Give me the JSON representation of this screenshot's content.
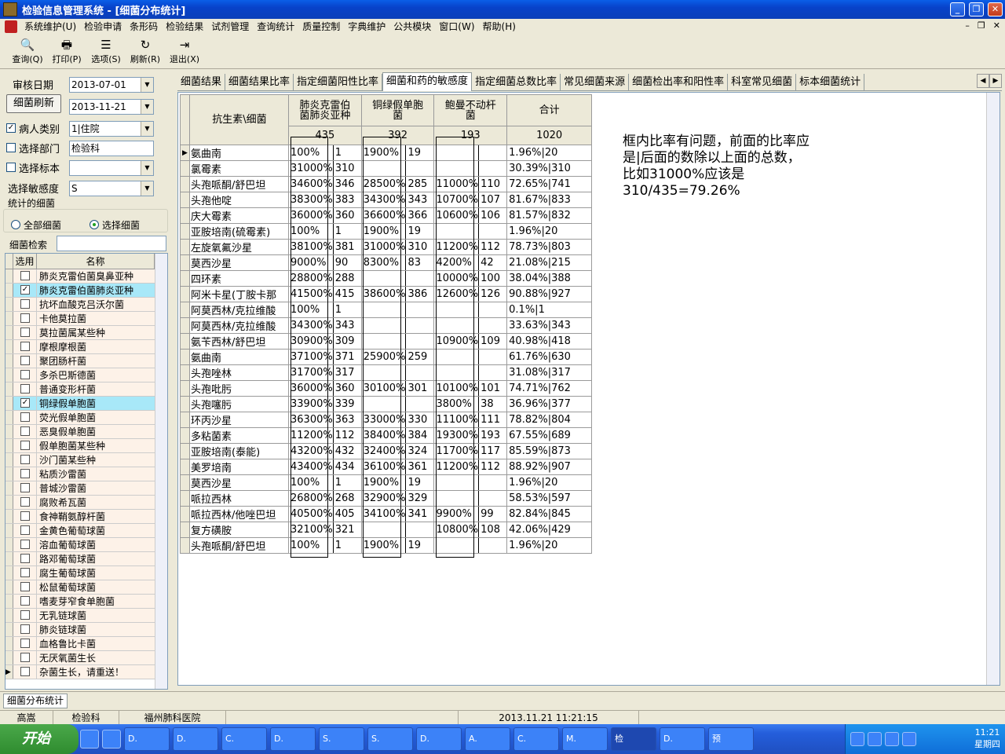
{
  "window": {
    "title": "检验信息管理系统 - [细菌分布统计]"
  },
  "menu": [
    "系统维护(U)",
    "检验申请",
    "条形码",
    "检验结果",
    "试剂管理",
    "查询统计",
    "质量控制",
    "字典维护",
    "公共模块",
    "窗口(W)",
    "帮助(H)"
  ],
  "toolbar": [
    {
      "label": "查询(Q)",
      "icon": "magnifier-icon",
      "glyph": "🔍"
    },
    {
      "label": "打印(P)",
      "icon": "printer-icon",
      "glyph": "🖶"
    },
    {
      "label": "选项(S)",
      "icon": "options-icon",
      "glyph": "☰"
    },
    {
      "label": "刷新(R)",
      "icon": "refresh-icon",
      "glyph": "↻"
    },
    {
      "label": "退出(X)",
      "icon": "exit-icon",
      "glyph": "⇥"
    }
  ],
  "filters": {
    "review_date_label": "审核日期",
    "date_from": "2013-07-01",
    "date_to": "2013-11-21",
    "refresh_button": "细菌刷新",
    "patient_type_label": "病人类别",
    "patient_type_value": "1|住院",
    "dept_label": "选择部门",
    "dept_value": "检验科",
    "specimen_label": "选择标本",
    "specimen_value": "",
    "sensitivity_label": "选择敏感度",
    "sensitivity_value": "S",
    "stat_group_label": "统计的细菌",
    "all_label": "全部细菌",
    "select_label": "选择细菌",
    "search_label": "细菌检索",
    "search_value": ""
  },
  "bacteria_list": {
    "col_use": "选用",
    "col_name": "名称",
    "items": [
      {
        "name": "肺炎克雷伯菌臭鼻亚种",
        "checked": false
      },
      {
        "name": "肺炎克雷伯菌肺炎亚种",
        "checked": true
      },
      {
        "name": "抗坏血酸克吕沃尔菌",
        "checked": false
      },
      {
        "name": "卡他莫拉菌",
        "checked": false
      },
      {
        "name": "莫拉菌属某些种",
        "checked": false
      },
      {
        "name": "摩根摩根菌",
        "checked": false
      },
      {
        "name": "聚团肠杆菌",
        "checked": false
      },
      {
        "name": "多杀巴斯德菌",
        "checked": false
      },
      {
        "name": "普通变形杆菌",
        "checked": false
      },
      {
        "name": "铜绿假单胞菌",
        "checked": true
      },
      {
        "name": "荧光假单胞菌",
        "checked": false
      },
      {
        "name": "恶臭假单胞菌",
        "checked": false
      },
      {
        "name": "假单胞菌某些种",
        "checked": false
      },
      {
        "name": "沙门菌某些种",
        "checked": false
      },
      {
        "name": "粘质沙雷菌",
        "checked": false
      },
      {
        "name": "普城沙雷菌",
        "checked": false
      },
      {
        "name": "腐败希瓦菌",
        "checked": false
      },
      {
        "name": "食神鞘氨醇杆菌",
        "checked": false
      },
      {
        "name": "金黄色葡萄球菌",
        "checked": false
      },
      {
        "name": "溶血葡萄球菌",
        "checked": false
      },
      {
        "name": "路邓葡萄球菌",
        "checked": false
      },
      {
        "name": "腐生葡萄球菌",
        "checked": false
      },
      {
        "name": "松鼠葡萄球菌",
        "checked": false
      },
      {
        "name": "嗜麦芽窄食单胞菌",
        "checked": false
      },
      {
        "name": "无乳链球菌",
        "checked": false
      },
      {
        "name": "肺炎链球菌",
        "checked": false
      },
      {
        "name": "血格鲁比卡菌",
        "checked": false
      },
      {
        "name": "无厌氧菌生长",
        "checked": false
      },
      {
        "name": "杂菌生长，请重送！",
        "checked": false
      }
    ]
  },
  "tabs": [
    "细菌结果",
    "细菌结果比率",
    "指定细菌阳性比率",
    "细菌和药的敏感度",
    "指定细菌总数比率",
    "常见细菌来源",
    "细菌检出率和阳性率",
    "科室常见细菌",
    "标本细菌统计"
  ],
  "active_tab": 3,
  "table": {
    "corner": "抗生素\\细菌",
    "columns": [
      {
        "name": "肺炎克雷伯\n菌肺炎亚种",
        "total": "435"
      },
      {
        "name": "铜绿假单胞\n菌",
        "total": "392"
      },
      {
        "name": "鲍曼不动杆\n菌",
        "total": "193"
      },
      {
        "name": "合计",
        "total": "1020"
      }
    ],
    "rows": [
      {
        "drug": "氨曲南",
        "c": [
          [
            "100%",
            "1"
          ],
          [
            "1900%",
            "19"
          ],
          [
            "",
            ""
          ]
        ],
        "total": "1.96%|20"
      },
      {
        "drug": "氯霉素",
        "c": [
          [
            "31000%",
            "310"
          ],
          [
            "",
            ""
          ],
          [
            "",
            ""
          ]
        ],
        "total": "30.39%|310"
      },
      {
        "drug": "头孢哌酮/舒巴坦",
        "c": [
          [
            "34600%",
            "346"
          ],
          [
            "28500%",
            "285"
          ],
          [
            "11000%",
            "110"
          ]
        ],
        "total": "72.65%|741"
      },
      {
        "drug": "头孢他啶",
        "c": [
          [
            "38300%",
            "383"
          ],
          [
            "34300%",
            "343"
          ],
          [
            "10700%",
            "107"
          ]
        ],
        "total": "81.67%|833"
      },
      {
        "drug": "庆大霉素",
        "c": [
          [
            "36000%",
            "360"
          ],
          [
            "36600%",
            "366"
          ],
          [
            "10600%",
            "106"
          ]
        ],
        "total": "81.57%|832"
      },
      {
        "drug": "亚胺培南(硫霉素)",
        "c": [
          [
            "100%",
            "1"
          ],
          [
            "1900%",
            "19"
          ],
          [
            "",
            ""
          ]
        ],
        "total": "1.96%|20"
      },
      {
        "drug": "左旋氧氟沙星",
        "c": [
          [
            "38100%",
            "381"
          ],
          [
            "31000%",
            "310"
          ],
          [
            "11200%",
            "112"
          ]
        ],
        "total": "78.73%|803"
      },
      {
        "drug": "莫西沙星",
        "c": [
          [
            "9000%",
            "90"
          ],
          [
            "8300%",
            "83"
          ],
          [
            "4200%",
            "42"
          ]
        ],
        "total": "21.08%|215"
      },
      {
        "drug": "四环素",
        "c": [
          [
            "28800%",
            "288"
          ],
          [
            "",
            ""
          ],
          [
            "10000%",
            "100"
          ]
        ],
        "total": "38.04%|388"
      },
      {
        "drug": "阿米卡星(丁胺卡那",
        "c": [
          [
            "41500%",
            "415"
          ],
          [
            "38600%",
            "386"
          ],
          [
            "12600%",
            "126"
          ]
        ],
        "total": "90.88%|927"
      },
      {
        "drug": "阿莫西林/克拉维酸",
        "c": [
          [
            "100%",
            "1"
          ],
          [
            "",
            ""
          ],
          [
            "",
            ""
          ]
        ],
        "total": "0.1%|1"
      },
      {
        "drug": "阿莫西林/克拉维酸",
        "c": [
          [
            "34300%",
            "343"
          ],
          [
            "",
            ""
          ],
          [
            "",
            ""
          ]
        ],
        "total": "33.63%|343"
      },
      {
        "drug": "氨苄西林/舒巴坦",
        "c": [
          [
            "30900%",
            "309"
          ],
          [
            "",
            ""
          ],
          [
            "10900%",
            "109"
          ]
        ],
        "total": "40.98%|418"
      },
      {
        "drug": "氨曲南",
        "c": [
          [
            "37100%",
            "371"
          ],
          [
            "25900%",
            "259"
          ],
          [
            "",
            ""
          ]
        ],
        "total": "61.76%|630"
      },
      {
        "drug": "头孢唑林",
        "c": [
          [
            "31700%",
            "317"
          ],
          [
            "",
            ""
          ],
          [
            "",
            ""
          ]
        ],
        "total": "31.08%|317"
      },
      {
        "drug": "头孢吡肟",
        "c": [
          [
            "36000%",
            "360"
          ],
          [
            "30100%",
            "301"
          ],
          [
            "10100%",
            "101"
          ]
        ],
        "total": "74.71%|762"
      },
      {
        "drug": "头孢噻肟",
        "c": [
          [
            "33900%",
            "339"
          ],
          [
            "",
            ""
          ],
          [
            "3800%",
            "38"
          ]
        ],
        "total": "36.96%|377"
      },
      {
        "drug": "环丙沙星",
        "c": [
          [
            "36300%",
            "363"
          ],
          [
            "33000%",
            "330"
          ],
          [
            "11100%",
            "111"
          ]
        ],
        "total": "78.82%|804"
      },
      {
        "drug": "多粘菌素",
        "c": [
          [
            "11200%",
            "112"
          ],
          [
            "38400%",
            "384"
          ],
          [
            "19300%",
            "193"
          ]
        ],
        "total": "67.55%|689"
      },
      {
        "drug": "亚胺培南(泰能)",
        "c": [
          [
            "43200%",
            "432"
          ],
          [
            "32400%",
            "324"
          ],
          [
            "11700%",
            "117"
          ]
        ],
        "total": "85.59%|873"
      },
      {
        "drug": "美罗培南",
        "c": [
          [
            "43400%",
            "434"
          ],
          [
            "36100%",
            "361"
          ],
          [
            "11200%",
            "112"
          ]
        ],
        "total": "88.92%|907"
      },
      {
        "drug": "莫西沙星",
        "c": [
          [
            "100%",
            "1"
          ],
          [
            "1900%",
            "19"
          ],
          [
            "",
            ""
          ]
        ],
        "total": "1.96%|20"
      },
      {
        "drug": "哌拉西林",
        "c": [
          [
            "26800%",
            "268"
          ],
          [
            "32900%",
            "329"
          ],
          [
            "",
            ""
          ]
        ],
        "total": "58.53%|597"
      },
      {
        "drug": "哌拉西林/他唑巴坦",
        "c": [
          [
            "40500%",
            "405"
          ],
          [
            "34100%",
            "341"
          ],
          [
            "9900%",
            "99"
          ]
        ],
        "total": "82.84%|845"
      },
      {
        "drug": "复方磺胺",
        "c": [
          [
            "32100%",
            "321"
          ],
          [
            "",
            ""
          ],
          [
            "10800%",
            "108"
          ]
        ],
        "total": "42.06%|429"
      },
      {
        "drug": "头孢哌酮/舒巴坦",
        "c": [
          [
            "100%",
            "1"
          ],
          [
            "1900%",
            "19"
          ],
          [
            "",
            ""
          ]
        ],
        "total": "1.96%|20"
      }
    ]
  },
  "annotation": "框内比率有问题，前面的比率应\n是|后面的数除以上面的总数，\n比如31000%应该是\n310/435=79.26%",
  "lower_tab": "细菌分布统计",
  "status": {
    "user": "高嵩",
    "dept": "检验科",
    "hospital": "福州肺科医院",
    "datetime": "2013.11.21 11:21:15"
  },
  "taskbar": {
    "start": "开始",
    "tasks": [
      "D.",
      "D.",
      "C.",
      "D.",
      "S.",
      "S.",
      "D.",
      "A.",
      "C.",
      "M.",
      "检",
      "D.",
      "预"
    ],
    "active_task": 10,
    "time": "11:21",
    "weekday": "星期四"
  }
}
